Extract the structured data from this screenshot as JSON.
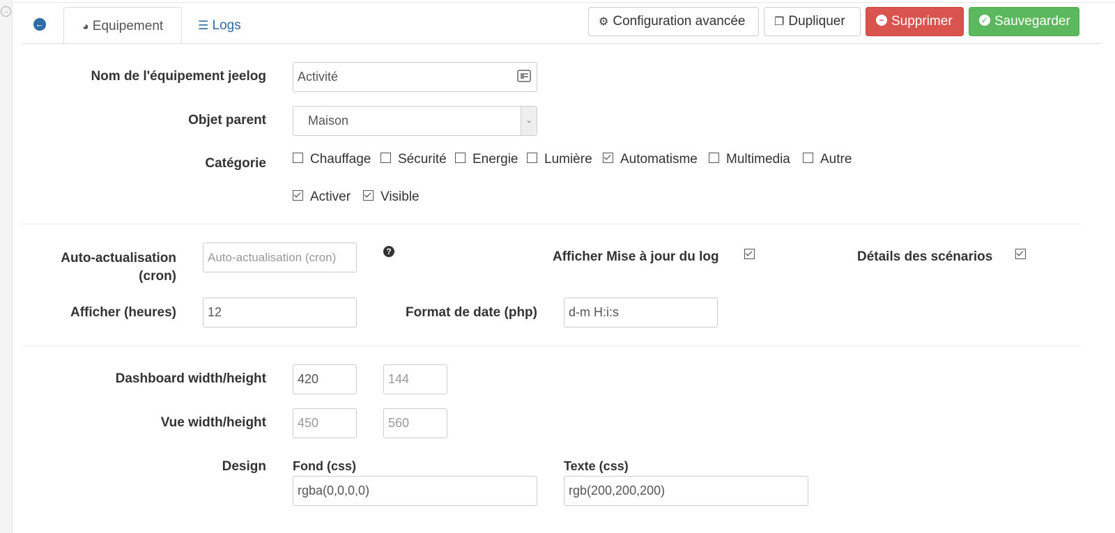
{
  "tabs": {
    "equipement": "Equipement",
    "logs": "Logs"
  },
  "toolbar": {
    "config": "Configuration avancée",
    "duplicate": "Dupliquer",
    "delete": "Supprimer",
    "save": "Sauvegarder"
  },
  "form": {
    "name_label": "Nom de l'équipement jeelog",
    "name_value": "Activité",
    "parent_label": "Objet parent",
    "parent_value": "Maison",
    "category_label": "Catégorie",
    "categories": [
      {
        "label": "Chauffage",
        "checked": false
      },
      {
        "label": "Sécurité",
        "checked": false
      },
      {
        "label": "Energie",
        "checked": false
      },
      {
        "label": "Lumière",
        "checked": false
      },
      {
        "label": "Automatisme",
        "checked": true
      },
      {
        "label": "Multimedia",
        "checked": false
      },
      {
        "label": "Autre",
        "checked": false
      }
    ],
    "activate_label": "Activer",
    "visible_label": "Visible"
  },
  "settings": {
    "cron_label_1": "Auto-actualisation",
    "cron_label_2": "(cron)",
    "cron_placeholder": "Auto-actualisation (cron)",
    "log_update_label": "Afficher Mise à jour du log",
    "scenario_details_label": "Détails des scénarios",
    "hours_label": "Afficher (heures)",
    "hours_value": "12",
    "date_format_label": "Format de date (php)",
    "date_format_value": "d-m H:i:s"
  },
  "display": {
    "dashboard_label": "Dashboard width/height",
    "dashboard_width": "420",
    "dashboard_height_placeholder": "144",
    "view_label": "Vue width/height",
    "view_width_placeholder": "450",
    "view_height_placeholder": "560",
    "design_label": "Design",
    "bg_label": "Fond (css)",
    "bg_value": "rgba(0,0,0,0)",
    "text_label": "Texte (css)",
    "text_value": "rgb(200,200,200)"
  },
  "colors": {
    "link": "#2d6ca6",
    "danger": "#d9534f",
    "success": "#5cb85c"
  }
}
